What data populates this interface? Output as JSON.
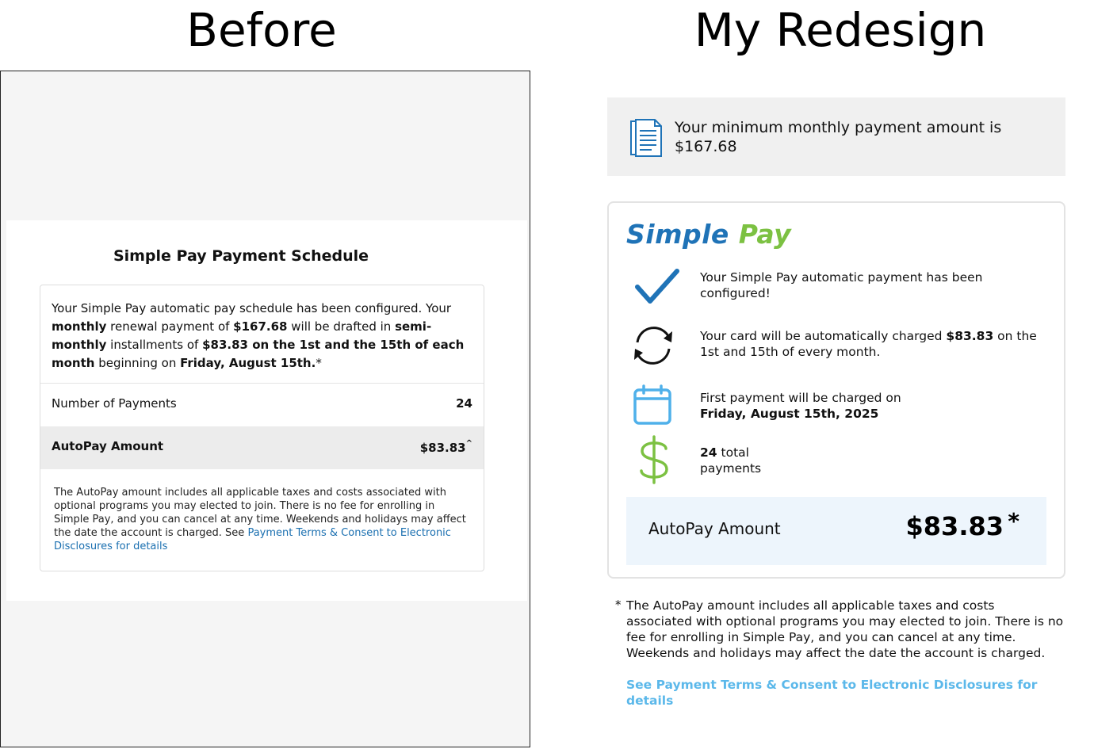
{
  "headings": {
    "before": "Before",
    "after": "My Redesign"
  },
  "before": {
    "title_brand": "Simple Pay",
    "title_rest": " Payment Schedule",
    "desc": [
      {
        "t": "Your Simple Pay automatic pay schedule has been configured. Your ",
        "b": false
      },
      {
        "t": "monthly",
        "b": true
      },
      {
        "t": " renewal payment of ",
        "b": false
      },
      {
        "t": "$167.68",
        "b": true
      },
      {
        "t": " will be drafted in ",
        "b": false
      },
      {
        "t": "semi-monthly",
        "b": true
      },
      {
        "t": " installments of ",
        "b": false
      },
      {
        "t": "$83.83 on the 1st and the 15th of each month",
        "b": true
      },
      {
        "t": " beginning on ",
        "b": false
      },
      {
        "t": "Friday, August 15th.",
        "b": true
      },
      {
        "t": "*",
        "b": false
      }
    ],
    "row_payments_label": "Number of Payments",
    "row_payments_value": "24",
    "row_autopay_label": "AutoPay Amount",
    "row_autopay_value": "$83.83",
    "row_autopay_mark": "^",
    "fine_print": "The AutoPay amount includes all applicable taxes and costs associated with optional programs you may elected to join. There is no fee for enrolling in Simple Pay, and you can cancel at any time. Weekends and holidays may affect the date the account is charged. See ",
    "fine_link": "Payment Terms & Consent to Electronic Disclosures for details"
  },
  "after": {
    "notice_text": "Your minimum monthly payment amount is $167.68",
    "logo_simple": "Simple",
    "logo_pay": "Pay",
    "items": [
      {
        "icon": "checkmark-icon",
        "parts": [
          {
            "t": "Your Simple Pay automatic payment has been configured!",
            "b": false
          }
        ]
      },
      {
        "icon": "refresh-cycle-icon",
        "parts": [
          {
            "t": "Your card will be automatically charged ",
            "b": false
          },
          {
            "t": "$83.83",
            "b": true
          },
          {
            "t": " on the 1st and 15th of every month.",
            "b": false
          }
        ]
      },
      {
        "icon": "calendar-icon",
        "parts": [
          {
            "t": "First payment will be charged on",
            "b": false
          },
          {
            "t": "\nFriday, August 15th, 2025",
            "b": true
          }
        ]
      },
      {
        "icon": "dollar-icon",
        "parts": [
          {
            "t": "24",
            "b": true
          },
          {
            "t": " total\npayments",
            "b": false
          }
        ]
      }
    ],
    "amount_label": "AutoPay Amount",
    "amount_value": "$83.83",
    "amount_mark": "*",
    "footnote_mark": "*",
    "footnote": "The AutoPay amount includes all applicable taxes and costs associated with optional programs you may elected to join. There is no fee for enrolling in Simple Pay, and you can cancel at any time. Weekends and holidays may affect the date the account is charged.",
    "terms_link": "See Payment Terms & Consent to Electronic Disclosures for details"
  },
  "colors": {
    "brand_blue": "#1f73b7",
    "brand_green": "#7cc142",
    "link_light_blue": "#5bb8ea",
    "link_blue": "#1a6fb0"
  }
}
